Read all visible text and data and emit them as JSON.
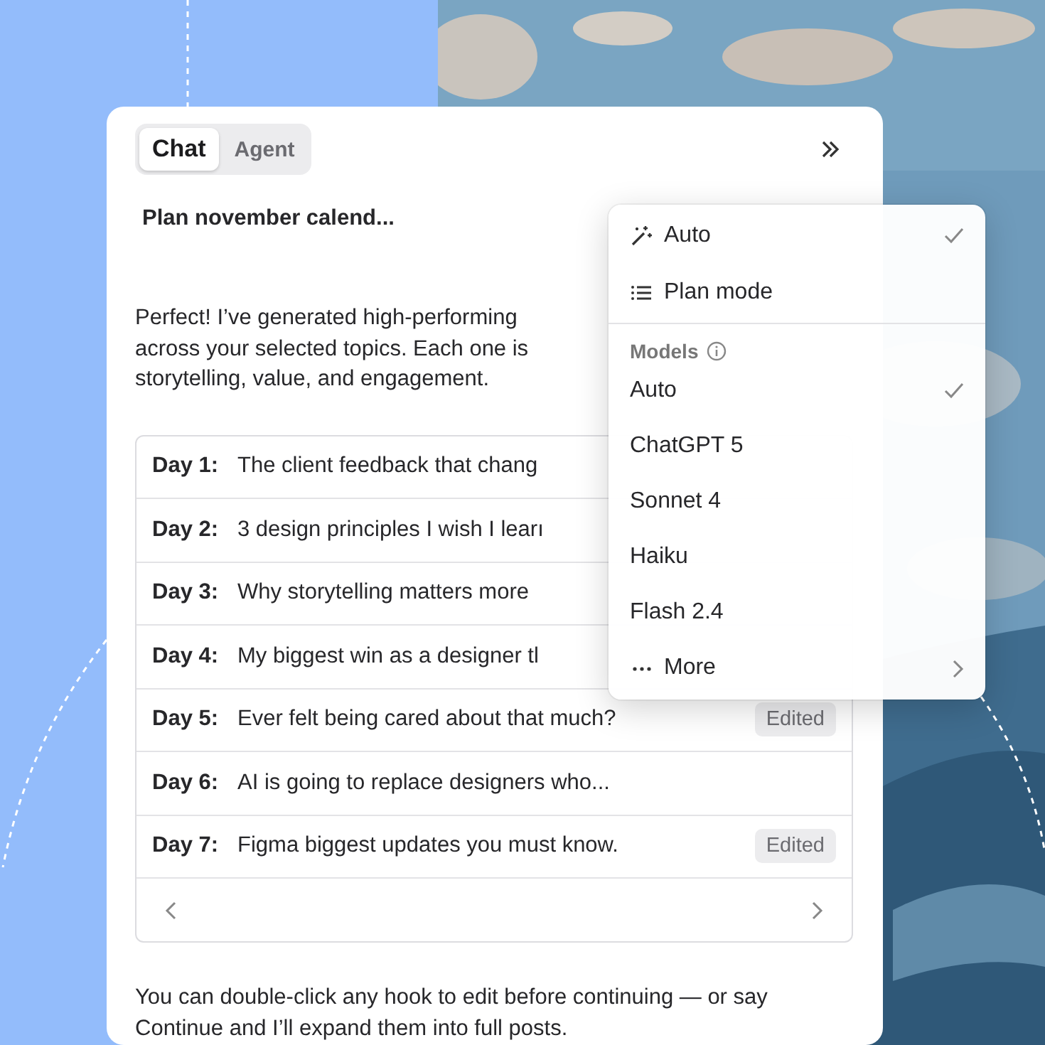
{
  "tabs": [
    {
      "label": "Chat",
      "selected": true
    },
    {
      "label": "Agent",
      "selected": false
    }
  ],
  "chat_title": "Plan november calend...",
  "message": [
    "Perfect! I’ve generated high-performing",
    "across your selected topics. Each one is",
    "storytelling, value, and engagement."
  ],
  "hooks": [
    {
      "day": "Day 1:",
      "text": "The client feedback that chang"
    },
    {
      "day": "Day 2:",
      "text": "3 design principles I wish I learı"
    },
    {
      "day": "Day 3:",
      "text": "Why storytelling matters more"
    },
    {
      "day": "Day 4:",
      "text": "My biggest win as a designer tl"
    },
    {
      "day": "Day 5:",
      "text": "Ever felt being cared about that much?",
      "badge": "Edited"
    },
    {
      "day": "Day 6:",
      "text": "AI is going to replace designers who..."
    },
    {
      "day": "Day 7:",
      "text": "Figma biggest updates you must know.",
      "badge": "Edited"
    }
  ],
  "footer_message": "You can double-click any hook to edit before continuing — or say Continue and I’ll expand them into full posts.",
  "menu": {
    "modes": [
      {
        "kind": "auto",
        "label": "Auto",
        "checked": true
      },
      {
        "kind": "plan",
        "label": "Plan mode",
        "checked": false
      }
    ],
    "models_header": "Models",
    "models": [
      {
        "label": "Auto",
        "checked": true
      },
      {
        "label": "ChatGPT 5",
        "checked": false
      },
      {
        "label": "Sonnet 4",
        "checked": false
      },
      {
        "label": "Haiku",
        "checked": false
      },
      {
        "label": "Flash 2.4",
        "checked": false
      }
    ],
    "more": "More"
  }
}
